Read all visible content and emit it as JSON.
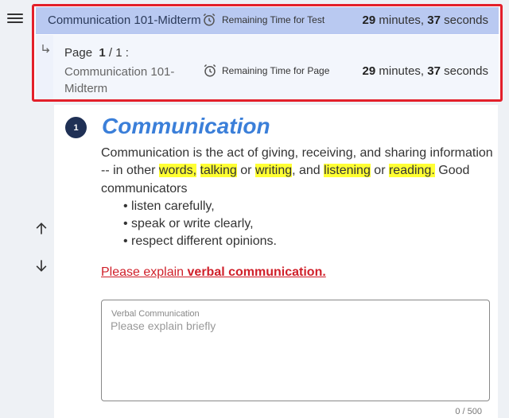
{
  "test": {
    "title": "Communication 101-Midterm",
    "remaining_label": "Remaining Time for Test",
    "minutes": "29",
    "minutes_unit": "minutes,",
    "seconds": "37",
    "seconds_unit": "seconds"
  },
  "page": {
    "prefix": "Page",
    "current": "1",
    "total_text": "/ 1 :",
    "name": "Communication 101-Midterm",
    "remaining_label": "Remaining Time for Page",
    "minutes": "29",
    "minutes_unit": "minutes,",
    "seconds": "37",
    "seconds_unit": "seconds"
  },
  "question": {
    "number": "1",
    "title": "Communication",
    "body_parts": [
      "Communication is the act of giving, receiving, and sharing information -- in other ",
      "words,",
      " ",
      "talking",
      " or ",
      "writing",
      ", and ",
      "listening",
      " or ",
      "reading.",
      " Good communicators"
    ],
    "bullets": [
      "listen carefully,",
      "speak or write clearly,",
      "respect different opinions."
    ],
    "prompt_plain": "Please explain ",
    "prompt_bold": "verbal communication. "
  },
  "answer": {
    "label": "Verbal Communication",
    "placeholder": "Please explain briefly",
    "value": "",
    "char_count": "0 / 500"
  },
  "colors": {
    "highlight": "#ffff33",
    "annotation_red": "#e3202a",
    "title_blue": "#3b7fd9",
    "test_bar": "#b9c9f1"
  },
  "icons": [
    "menu-icon",
    "alarm-clock-icon",
    "subdirectory-arrow-icon",
    "arrow-up-icon",
    "arrow-down-icon",
    "annotation-arrow-icon"
  ]
}
